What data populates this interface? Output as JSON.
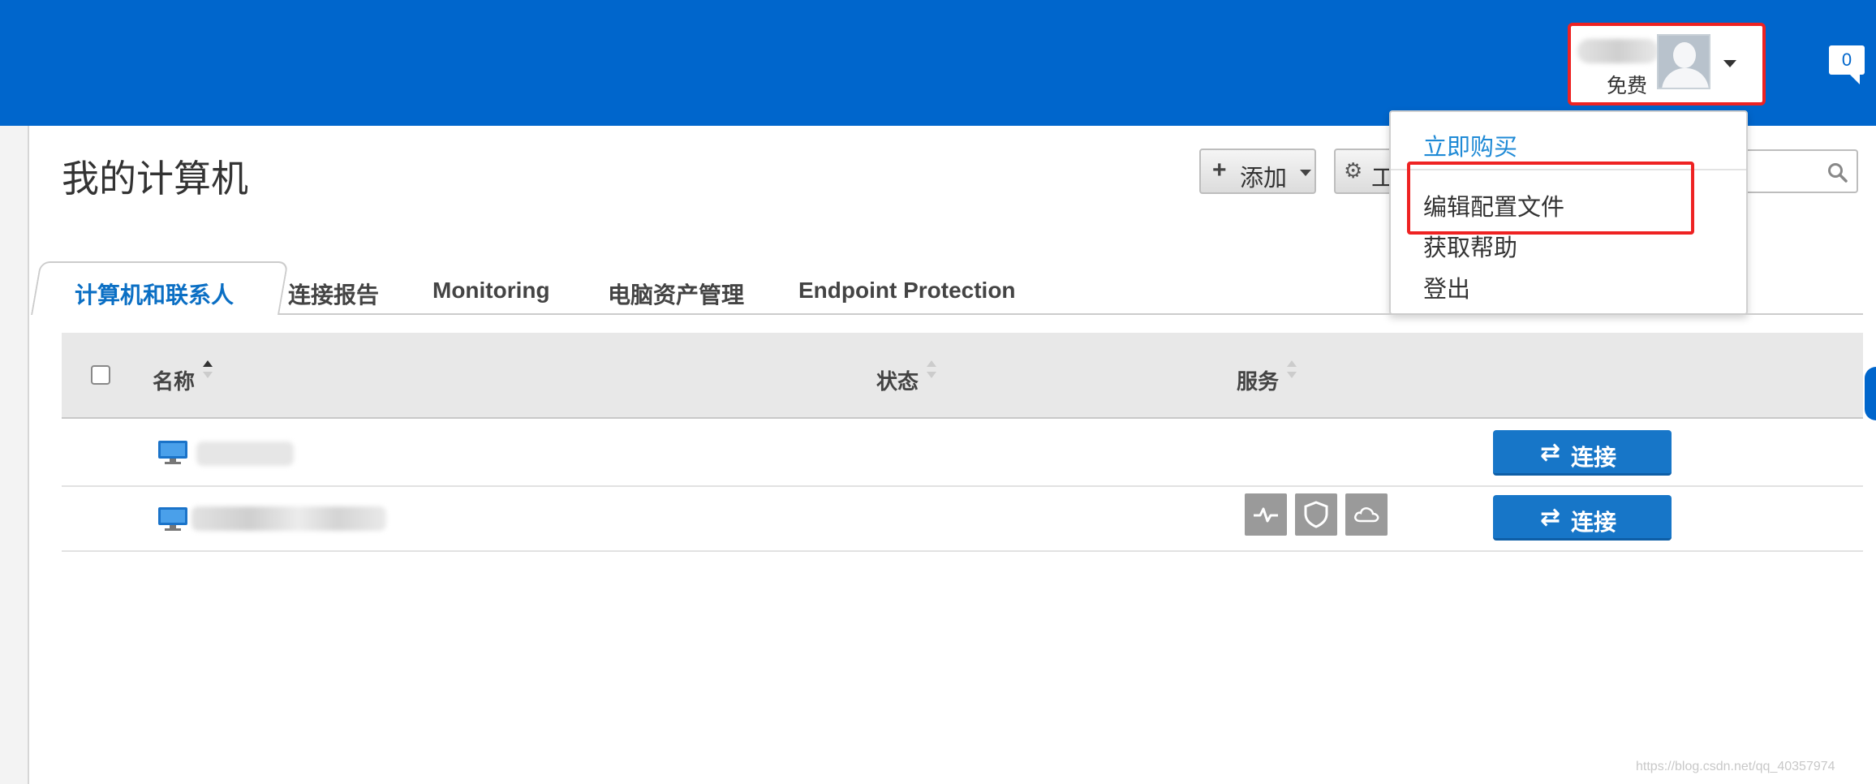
{
  "account": {
    "plan": "免费",
    "notifications": "0"
  },
  "page": {
    "title": "我的计算机"
  },
  "toolbar": {
    "add_label": "添加",
    "tools_label": "工"
  },
  "account_menu": {
    "items": [
      "立即购买",
      "编辑配置文件",
      "获取帮助",
      "登出"
    ]
  },
  "tabs": [
    {
      "label": "计算机和联系人",
      "active": true
    },
    {
      "label": "连接报告"
    },
    {
      "label": "Monitoring"
    },
    {
      "label": "电脑资产管理"
    },
    {
      "label": "Endpoint Protection"
    }
  ],
  "table": {
    "columns": [
      "名称",
      "状态",
      "服务"
    ],
    "rows": [
      {
        "name": "",
        "status": "",
        "services": [],
        "action": "连接"
      },
      {
        "name": "",
        "status": "",
        "services": [
          "monitoring-icon",
          "shield-icon",
          "cloud-icon"
        ],
        "action": "连接"
      }
    ]
  },
  "watermark": "https://blog.csdn.net/qq_40357974",
  "colors": {
    "brand_blue": "#0066cc",
    "button_blue": "#1776c8",
    "highlight_red": "#ee2222"
  }
}
